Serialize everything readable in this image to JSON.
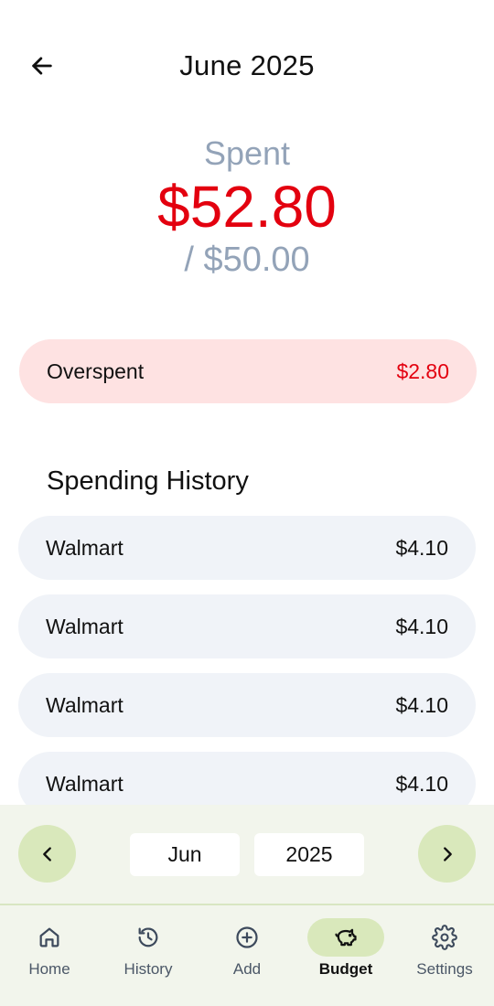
{
  "header": {
    "title": "June 2025",
    "back_icon": "arrow-left-icon"
  },
  "summary": {
    "spent_label": "Spent",
    "spent_amount": "$52.80",
    "budget_total": "/ $50.00"
  },
  "overspent": {
    "label": "Overspent",
    "amount": "$2.80"
  },
  "history": {
    "title": "Spending History",
    "items": [
      {
        "merchant": "Walmart",
        "amount": "$4.10"
      },
      {
        "merchant": "Walmart",
        "amount": "$4.10"
      },
      {
        "merchant": "Walmart",
        "amount": "$4.10"
      },
      {
        "merchant": "Walmart",
        "amount": "$4.10"
      }
    ]
  },
  "month_picker": {
    "month": "Jun",
    "year": "2025",
    "prev_icon": "chevron-left-icon",
    "next_icon": "chevron-right-icon"
  },
  "bottom_nav": {
    "items": [
      {
        "label": "Home",
        "icon": "home-icon",
        "active": false
      },
      {
        "label": "History",
        "icon": "history-icon",
        "active": false
      },
      {
        "label": "Add",
        "icon": "plus-circle-icon",
        "active": false
      },
      {
        "label": "Budget",
        "icon": "piggy-bank-icon",
        "active": true
      },
      {
        "label": "Settings",
        "icon": "gear-icon",
        "active": false
      }
    ]
  },
  "colors": {
    "overspent_red": "#e3000f",
    "muted_text": "#93a3b8",
    "overspent_bg": "#fee2e2",
    "card_bg": "#f0f3f8",
    "green_accent": "#d9e8bb",
    "panel_bg": "#f2f5ec"
  }
}
